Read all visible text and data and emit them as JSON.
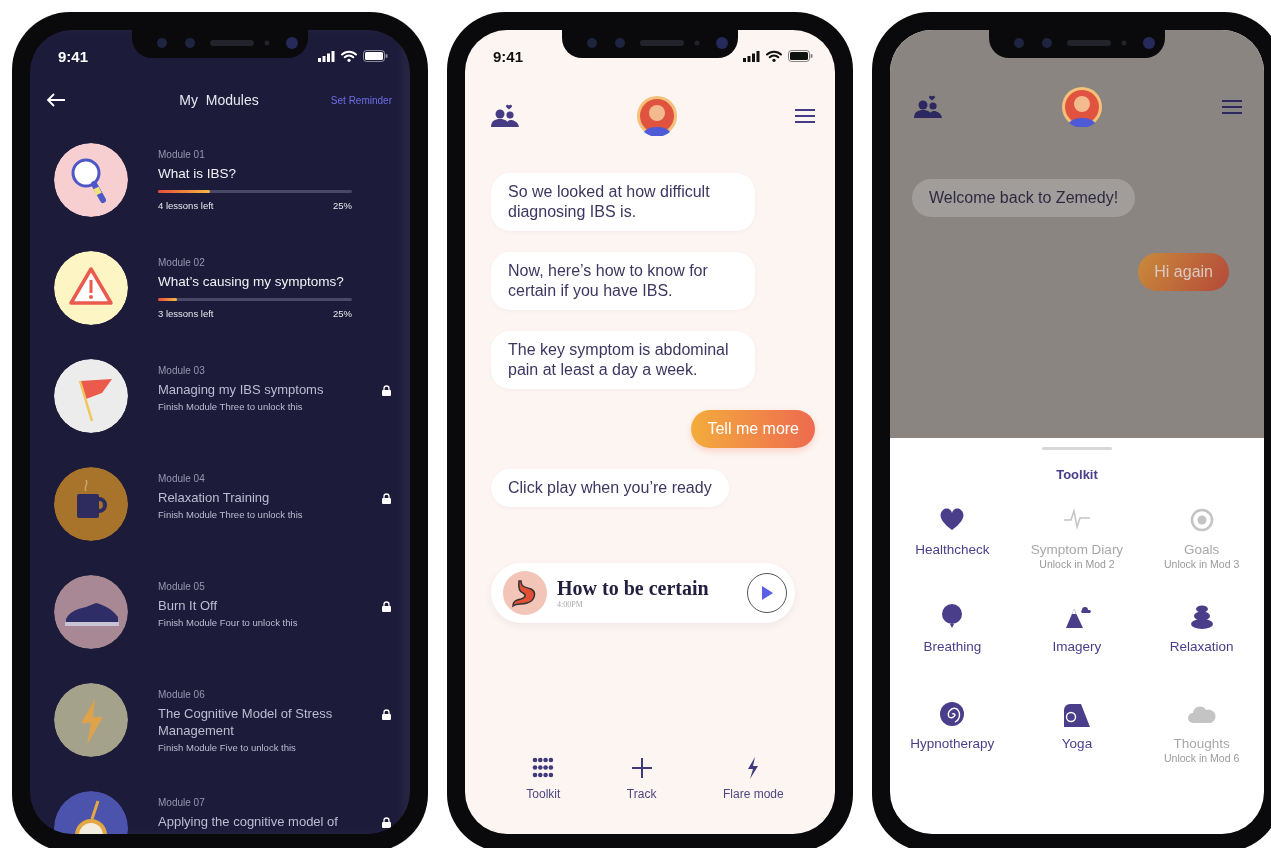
{
  "phones": [
    {
      "kind": "modules",
      "status_time": "9:41",
      "title": "My  Modules",
      "action": "Set Reminder",
      "modules": [
        {
          "number": "Module 01",
          "title": "What is IBS?",
          "locked": false,
          "level": 0.27,
          "lessons_left": "4 lessons left",
          "percent": "25%"
        },
        {
          "number": "Module 02",
          "title": "What’s causing my symptoms?",
          "locked": false,
          "level": 0.1,
          "lessons_left": "3 lessons left",
          "percent": "25%"
        },
        {
          "number": "Module 03",
          "title": "Managing my IBS symptoms",
          "locked": true,
          "hint": "Finish Module Three to unlock this"
        },
        {
          "number": "Module 04",
          "title": "Relaxation Training",
          "locked": true,
          "hint": "Finish Module Three to unlock this"
        },
        {
          "number": "Module 05",
          "title": "Burn It Off",
          "locked": true,
          "hint": "Finish Module Four to unlock this"
        },
        {
          "number": "Module 06",
          "title": "The Cognitive Model of Stress Management",
          "locked": true,
          "hint": "Finish Module Five to unlock this"
        },
        {
          "number": "Module 07",
          "title": "Applying the cognitive model of",
          "locked": true
        }
      ]
    },
    {
      "kind": "chat",
      "status_time": "9:41",
      "messages": [
        {
          "kind": "bot",
          "text": "So we looked at how difficult diagnosing IBS is."
        },
        {
          "kind": "bot",
          "text": "Now, here’s how to know for certain if you have IBS."
        },
        {
          "kind": "bot",
          "text": "The key symptom is abdominal pain at least a day a week."
        },
        {
          "kind": "user",
          "text": "Tell me more"
        },
        {
          "kind": "bot",
          "text": "Click play when you’re ready"
        }
      ],
      "audio_card": {
        "title": "How to be certain",
        "time": "4:00PM"
      },
      "nav": [
        "Toolkit",
        "Track",
        "Flare mode"
      ]
    },
    {
      "kind": "toolkit",
      "messages": [
        {
          "kind": "bot",
          "text": "Welcome back to Zemedy!"
        },
        {
          "kind": "user",
          "text": "Hi again"
        }
      ],
      "sheet_title": "Toolkit",
      "tools": [
        {
          "label": "Healthcheck",
          "locked": false
        },
        {
          "label": "Symptom Diary",
          "locked": true,
          "hint": "Unlock in Mod 2"
        },
        {
          "label": "Goals",
          "locked": true,
          "hint": "Unlock in Mod 3"
        },
        {
          "label": "Breathing",
          "locked": false
        },
        {
          "label": "Imagery",
          "locked": false
        },
        {
          "label": "Relaxation",
          "locked": false
        },
        {
          "label": "Hypnotherapy",
          "locked": false
        },
        {
          "label": "Yoga",
          "locked": false
        },
        {
          "label": "Thoughts",
          "locked": true,
          "hint": "Unlock in Mod 6"
        }
      ]
    }
  ]
}
